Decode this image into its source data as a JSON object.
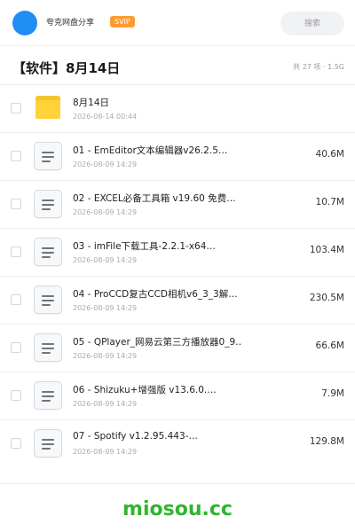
{
  "header": {
    "share_title": "夸克网盘分享",
    "badge": "SVIP",
    "search_placeholder": "搜索"
  },
  "folder": {
    "title": "【软件】8月14日",
    "summary": "共 27 项 · 1.5G"
  },
  "items": [
    {
      "type": "folder",
      "icon": "folder-icon",
      "name": "8月14日",
      "date": "2026-08-14 00:44",
      "size": ""
    },
    {
      "type": "file",
      "icon": "document-icon",
      "name": "01 - EmEditor文本编辑器v26.2.5…",
      "date": "2026-08-09 14:29",
      "size": "40.6M"
    },
    {
      "type": "file",
      "icon": "document-icon",
      "name": "02 - EXCEL必备工具箱 v19.60 免费…",
      "date": "2026-08-09 14:29",
      "size": "10.7M"
    },
    {
      "type": "file",
      "icon": "document-icon",
      "name": "03 - imFile下载工具-2.2.1-x64…",
      "date": "2026-08-09 14:29",
      "size": "103.4M"
    },
    {
      "type": "file",
      "icon": "document-icon",
      "name": "04 - ProCCD复古CCD相机v6_3_3解…",
      "date": "2026-08-09 14:29",
      "size": "230.5M"
    },
    {
      "type": "file",
      "icon": "document-icon",
      "name": "05 - QPlayer_网易云第三方播放器0_9…",
      "date": "2026-08-09 14:29",
      "size": "66.6M"
    },
    {
      "type": "file",
      "icon": "document-icon",
      "name": "06 - Shizuku+增强版 v13.6.0.…",
      "date": "2026-08-09 14:29",
      "size": "7.9M"
    },
    {
      "type": "file",
      "icon": "document-icon",
      "name": "07 - Spotify v1.2.95.443-…",
      "date": "2026-08-09 14:29",
      "size": "129.8M"
    }
  ],
  "watermark": "miosou.cc",
  "colors": {
    "accent": "#1f8ef5",
    "svip": "#ff9c31",
    "folder": "#ffd23a",
    "watermark": "#2fb52f"
  }
}
